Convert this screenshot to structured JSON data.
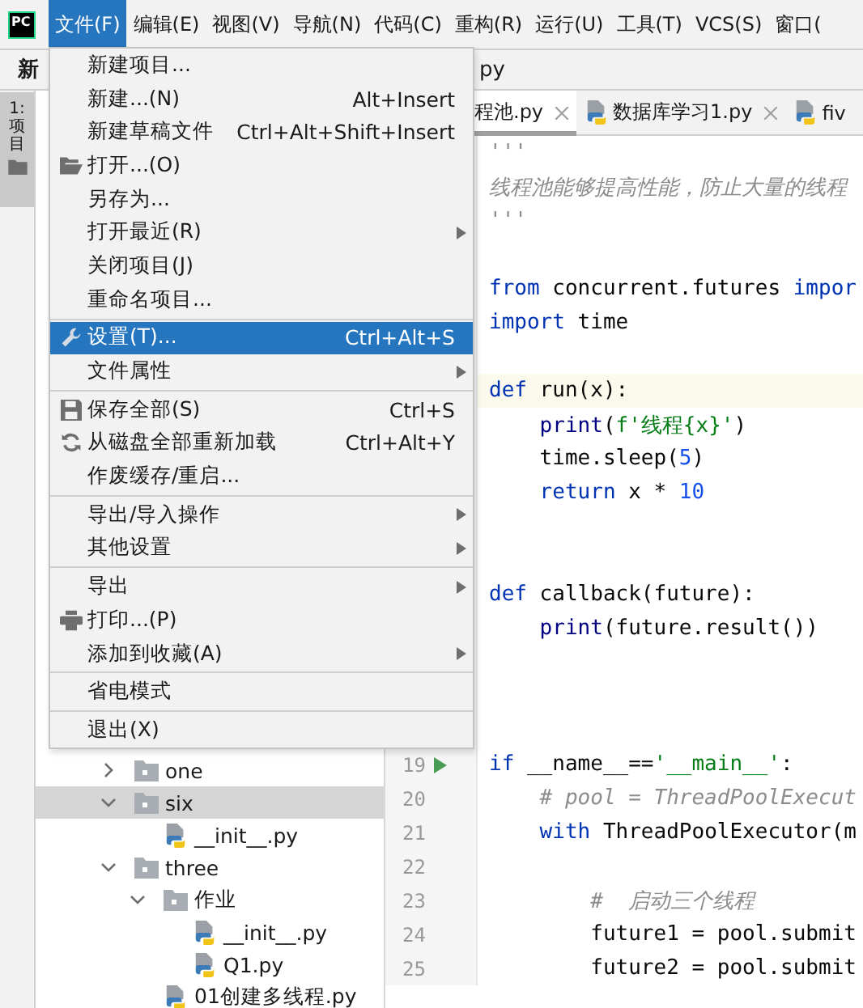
{
  "logo": "PC",
  "menubar": {
    "items": [
      {
        "label": "文件(F)",
        "selected": true
      },
      {
        "label": "编辑(E)",
        "selected": false
      },
      {
        "label": "视图(V)",
        "selected": false
      },
      {
        "label": "导航(N)",
        "selected": false
      },
      {
        "label": "代码(C)",
        "selected": false
      },
      {
        "label": "重构(R)",
        "selected": false
      },
      {
        "label": "运行(U)",
        "selected": false
      },
      {
        "label": "工具(T)",
        "selected": false
      },
      {
        "label": "VCS(S)",
        "selected": false
      },
      {
        "label": "窗口(",
        "selected": false
      }
    ]
  },
  "navbar": {
    "items": [
      "新",
      "py"
    ]
  },
  "tool_strip": {
    "tabs": [
      {
        "label": "1: 项目",
        "selected": true
      }
    ]
  },
  "file_menu": {
    "sections": [
      [
        {
          "label": "新建项目...",
          "submenu": false,
          "selected": false
        },
        {
          "label": "新建...(N)",
          "shortcut": "Alt+Insert",
          "submenu": false,
          "selected": false
        },
        {
          "label": "新建草稿文件",
          "shortcut": "Ctrl+Alt+Shift+Insert",
          "submenu": false,
          "selected": false
        },
        {
          "label": "打开...(O)",
          "kind": "folder",
          "submenu": false,
          "selected": false
        },
        {
          "label": "另存为...",
          "submenu": false,
          "selected": false
        },
        {
          "label": "打开最近(R)",
          "submenu": true,
          "selected": false
        },
        {
          "label": "关闭项目(J)",
          "submenu": false,
          "selected": false
        },
        {
          "label": "重命名项目...",
          "submenu": false,
          "selected": false
        }
      ],
      [
        {
          "label": "设置(T)...",
          "shortcut": "Ctrl+Alt+S",
          "kind": "wrench",
          "submenu": false,
          "selected": true
        },
        {
          "label": "文件属性",
          "submenu": true,
          "selected": false
        }
      ],
      [
        {
          "label": "保存全部(S)",
          "shortcut": "Ctrl+S",
          "kind": "save",
          "submenu": false,
          "selected": false
        },
        {
          "label": "从磁盘全部重新加载",
          "shortcut": "Ctrl+Alt+Y",
          "kind": "reload",
          "submenu": false,
          "selected": false
        },
        {
          "label": "作废缓存/重启...",
          "submenu": false,
          "selected": false
        }
      ],
      [
        {
          "label": "导出/导入操作",
          "submenu": true,
          "selected": false
        },
        {
          "label": "其他设置",
          "submenu": true,
          "selected": false
        }
      ],
      [
        {
          "label": "导出",
          "submenu": true,
          "selected": false
        },
        {
          "label": "打印...(P)",
          "kind": "printer",
          "submenu": false,
          "selected": false
        },
        {
          "label": "添加到收藏(A)",
          "submenu": true,
          "selected": false
        }
      ],
      [
        {
          "label": "省电模式",
          "submenu": false,
          "selected": false
        }
      ],
      [
        {
          "label": "退出(X)",
          "submenu": false,
          "selected": false
        }
      ]
    ]
  },
  "project_tree": [
    {
      "label": "one",
      "kind": "folder",
      "expanded": false,
      "selected": false
    },
    {
      "label": "six",
      "kind": "folder",
      "expanded": true,
      "selected": true,
      "children": [
        {
          "label": "__init__.py",
          "kind": "python",
          "selected": false
        }
      ]
    },
    {
      "label": "three",
      "kind": "folder",
      "expanded": true,
      "selected": false,
      "children": [
        {
          "label": "作业",
          "kind": "folder",
          "expanded": true,
          "selected": false,
          "children": [
            {
              "label": "__init__.py",
              "kind": "python",
              "selected": false
            },
            {
              "label": "Q1.py",
              "kind": "python",
              "selected": false
            }
          ]
        },
        {
          "label": "01创建多线程.py",
          "kind": "python",
          "selected": false
        }
      ]
    }
  ],
  "editor": {
    "tabs": [
      {
        "label": "程池.py",
        "selected": true,
        "closable": true
      },
      {
        "label": "数据库学习1.py",
        "kind": "python",
        "selected": false,
        "closable": true
      },
      {
        "label": "fiv",
        "kind": "python",
        "selected": false,
        "closable": false
      }
    ],
    "lines": [
      {
        "current": false,
        "tokens": [
          {
            "t": "'''",
            "kind": "doc"
          }
        ]
      },
      {
        "current": false,
        "tokens": [
          {
            "t": "线程池能够提高性能，防止大量的线程",
            "kind": "doc"
          }
        ]
      },
      {
        "current": false,
        "tokens": [
          {
            "t": "'''",
            "kind": "doc"
          }
        ]
      },
      {
        "current": false
      },
      {
        "current": false,
        "tokens": [
          {
            "t": "from",
            "kind": "kw"
          },
          {
            "t": " concurrent.futures ",
            "kind": "plain"
          },
          {
            "t": "impor",
            "kind": "kw"
          }
        ]
      },
      {
        "current": false,
        "tokens": [
          {
            "t": "import",
            "kind": "kw"
          },
          {
            "t": " time",
            "kind": "plain"
          }
        ]
      },
      {
        "current": false
      },
      {
        "current": true,
        "tokens": [
          {
            "t": "def",
            "kind": "kw"
          },
          {
            "t": " run(x):",
            "kind": "plain"
          }
        ]
      },
      {
        "current": false,
        "tokens": [
          {
            "t": "    print",
            "kind": "builtin"
          },
          {
            "t": "(",
            "kind": "plain"
          },
          {
            "t": "f'线程{x}'",
            "kind": "str"
          },
          {
            "t": ")",
            "kind": "plain"
          }
        ]
      },
      {
        "current": false,
        "tokens": [
          {
            "t": "    time.sleep(",
            "kind": "plain"
          },
          {
            "t": "5",
            "kind": "num"
          },
          {
            "t": ")",
            "kind": "plain"
          }
        ]
      },
      {
        "current": false,
        "tokens": [
          {
            "t": "    return",
            "kind": "kw"
          },
          {
            "t": " x * ",
            "kind": "plain"
          },
          {
            "t": "10",
            "kind": "num"
          }
        ]
      },
      {
        "current": false
      },
      {
        "current": false
      },
      {
        "current": false,
        "tokens": [
          {
            "t": "def",
            "kind": "kw"
          },
          {
            "t": " callback(future):",
            "kind": "plain"
          }
        ]
      },
      {
        "current": false,
        "tokens": [
          {
            "t": "    print",
            "kind": "builtin"
          },
          {
            "t": "(future.result())",
            "kind": "plain"
          }
        ]
      },
      {
        "current": false
      },
      {
        "current": false
      },
      {
        "current": false
      },
      {
        "number": "19",
        "run_marker": true,
        "current": false,
        "tokens": [
          {
            "t": "if",
            "kind": "kw"
          },
          {
            "t": " __name__==",
            "kind": "plain"
          },
          {
            "t": "'__main__'",
            "kind": "str"
          },
          {
            "t": ":",
            "kind": "plain"
          }
        ]
      },
      {
        "number": "20",
        "current": false,
        "tokens": [
          {
            "t": "    # pool = ThreadPoolExecut",
            "kind": "com"
          }
        ]
      },
      {
        "number": "21",
        "current": false,
        "tokens": [
          {
            "t": "    with",
            "kind": "kw"
          },
          {
            "t": " ThreadPoolExecutor(m",
            "kind": "plain"
          }
        ]
      },
      {
        "number": "22",
        "current": false
      },
      {
        "number": "23",
        "current": false,
        "tokens": [
          {
            "t": "        #  启动三个线程",
            "kind": "com"
          }
        ]
      },
      {
        "number": "24",
        "current": false,
        "tokens": [
          {
            "t": "        future1 = pool.submit",
            "kind": "plain"
          }
        ]
      },
      {
        "number": "25",
        "current": false,
        "tokens": [
          {
            "t": "        future2 = pool.submit",
            "kind": "plain"
          }
        ]
      }
    ]
  }
}
